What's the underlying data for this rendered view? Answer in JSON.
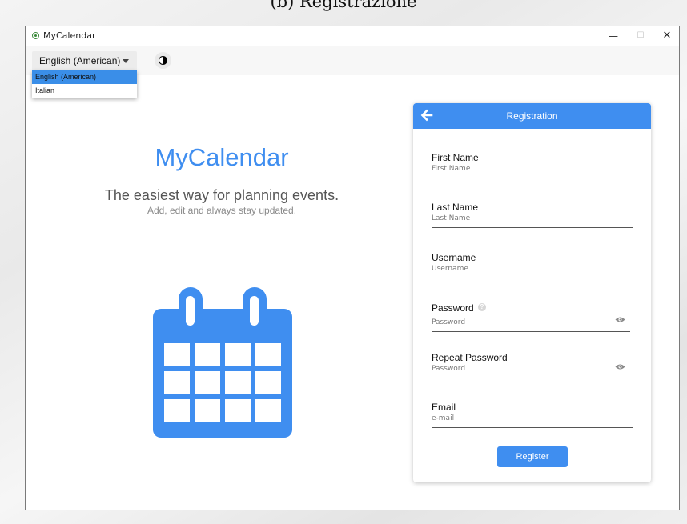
{
  "caption": "(b) Registrazione",
  "window": {
    "title": "MyCalendar",
    "minimize_glyph": "—",
    "maximize_glyph": "☐",
    "close_glyph": "✕"
  },
  "toolbar": {
    "language_selected": "English (American)",
    "theme_icon": "contrast-icon"
  },
  "language_dropdown": {
    "options": [
      "English (American)",
      "Italian"
    ],
    "selected_index": 0
  },
  "hero": {
    "title": "MyCalendar",
    "subtitle": "The easiest way for planning events.",
    "tagline": "Add, edit and always stay updated.",
    "icon": "calendar-icon"
  },
  "registration": {
    "header_title": "Registration",
    "back_icon": "back-arrow-icon",
    "fields": {
      "first_name": {
        "label": "First Name",
        "placeholder": "First Name"
      },
      "last_name": {
        "label": "Last Name",
        "placeholder": "Last Name"
      },
      "username": {
        "label": "Username",
        "placeholder": "Username"
      },
      "password": {
        "label": "Password",
        "placeholder": "Password",
        "help_glyph": "?"
      },
      "repeat_password": {
        "label": "Repeat Password",
        "placeholder": "Password"
      },
      "email": {
        "label": "Email",
        "placeholder": "e-mail"
      }
    },
    "submit_label": "Register"
  },
  "colors": {
    "accent": "#3f8ef0",
    "selected_option": "#3a8ee8",
    "underline": "#555555"
  }
}
